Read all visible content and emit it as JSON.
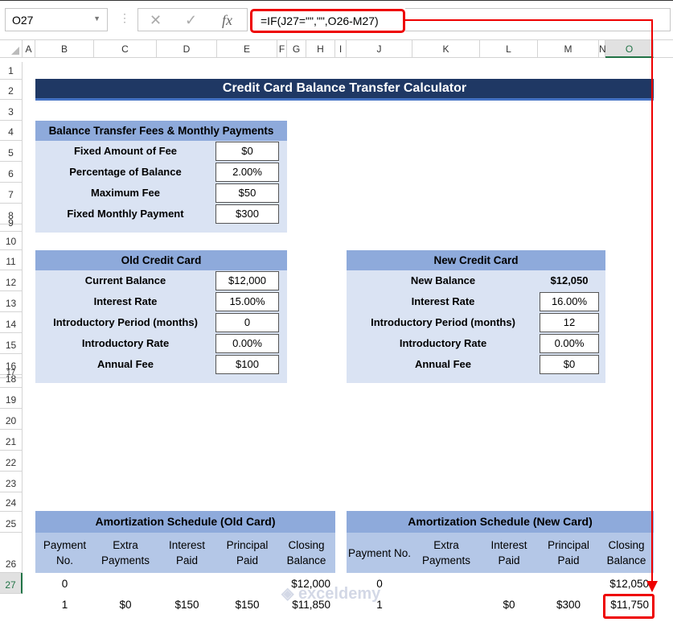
{
  "toolbar": {
    "name_box": "O27",
    "cancel_icon": "✕",
    "enter_icon": "✓",
    "fx_label": "fx",
    "formula": "=IF(J27=\"\",\"\",O26-M27)"
  },
  "columns": [
    "A",
    "B",
    "C",
    "D",
    "E",
    "F",
    "G",
    "H",
    "I",
    "J",
    "K",
    "L",
    "M",
    "N",
    "O"
  ],
  "selected_column": "O",
  "rows": [
    "1",
    "2",
    "3",
    "4",
    "5",
    "6",
    "7",
    "8",
    "9",
    "10",
    "11",
    "12",
    "13",
    "14",
    "15",
    "16",
    "17",
    "18",
    "19",
    "20",
    "21",
    "22",
    "23",
    "24",
    "25",
    "26",
    "27"
  ],
  "selected_row": "27",
  "title": "Credit Card Balance Transfer Calculator",
  "fees": {
    "header": "Balance Transfer Fees & Monthly Payments",
    "items": [
      {
        "label": "Fixed Amount of Fee",
        "value": "$0"
      },
      {
        "label": "Percentage of Balance",
        "value": "2.00%"
      },
      {
        "label": "Maximum Fee",
        "value": "$50"
      },
      {
        "label": "Fixed Monthly Payment",
        "value": "$300"
      }
    ]
  },
  "old_card": {
    "header": "Old Credit Card",
    "items": [
      {
        "label": "Current Balance",
        "value": "$12,000"
      },
      {
        "label": "Interest Rate",
        "value": "15.00%"
      },
      {
        "label": "Introductory Period (months)",
        "value": "0"
      },
      {
        "label": "Introductory Rate",
        "value": "0.00%"
      },
      {
        "label": "Annual Fee",
        "value": "$100"
      }
    ]
  },
  "new_card": {
    "header": "New Credit Card",
    "items": [
      {
        "label": "New Balance",
        "value": "$12,050"
      },
      {
        "label": "Interest Rate",
        "value": "16.00%"
      },
      {
        "label": "Introductory Period (months)",
        "value": "12"
      },
      {
        "label": "Introductory Rate",
        "value": "0.00%"
      },
      {
        "label": "Annual Fee",
        "value": "$0"
      }
    ]
  },
  "amort_old": {
    "header": "Amortization Schedule (Old Card)",
    "columns": [
      "Payment No.",
      "Extra Payments",
      "Interest Paid",
      "Principal Paid",
      "Closing Balance"
    ],
    "rows": [
      [
        "0",
        "",
        "",
        "",
        "$12,000"
      ],
      [
        "1",
        "$0",
        "$150",
        "$150",
        "$11,850"
      ]
    ]
  },
  "amort_new": {
    "header": "Amortization Schedule (New Card)",
    "columns": [
      "Payment No.",
      "Extra Payments",
      "Interest Paid",
      "Principal Paid",
      "Closing Balance"
    ],
    "rows": [
      [
        "0",
        "",
        "",
        "",
        "$12,050"
      ],
      [
        "1",
        "",
        "$0",
        "$300",
        "$11,750"
      ]
    ]
  },
  "watermark": "exceldemy",
  "colors": {
    "title_bg": "#1f3864",
    "header_bg": "#8eaadb",
    "panel_bg": "#dae3f3",
    "subheader_bg": "#b4c7e7",
    "highlight": "#ee0000"
  }
}
